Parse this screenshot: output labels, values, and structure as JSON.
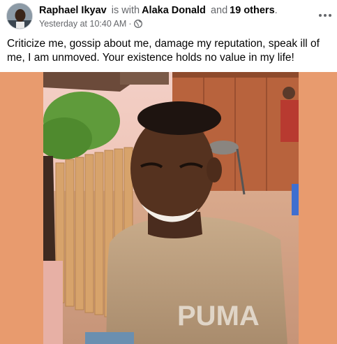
{
  "post": {
    "author": "Raphael Ikyav",
    "with_text": "is with",
    "tagged_person": "Alaka Donald",
    "and_text": "and",
    "others": "19 others",
    "period": ".",
    "timestamp": "Yesterday at 10:40 AM",
    "separator": "·",
    "audience_icon": "globe-icon",
    "more_icon": "more-options-icon",
    "caption": "Criticize me, gossip about me, damage my reputation, speak ill of me, I am unmoved. Your existence holds no value in my life!",
    "photo_text": "PUMA"
  },
  "colors": {
    "photo_background": "#e89b6e",
    "secondary_text": "#65676b",
    "primary_text": "#050505"
  }
}
